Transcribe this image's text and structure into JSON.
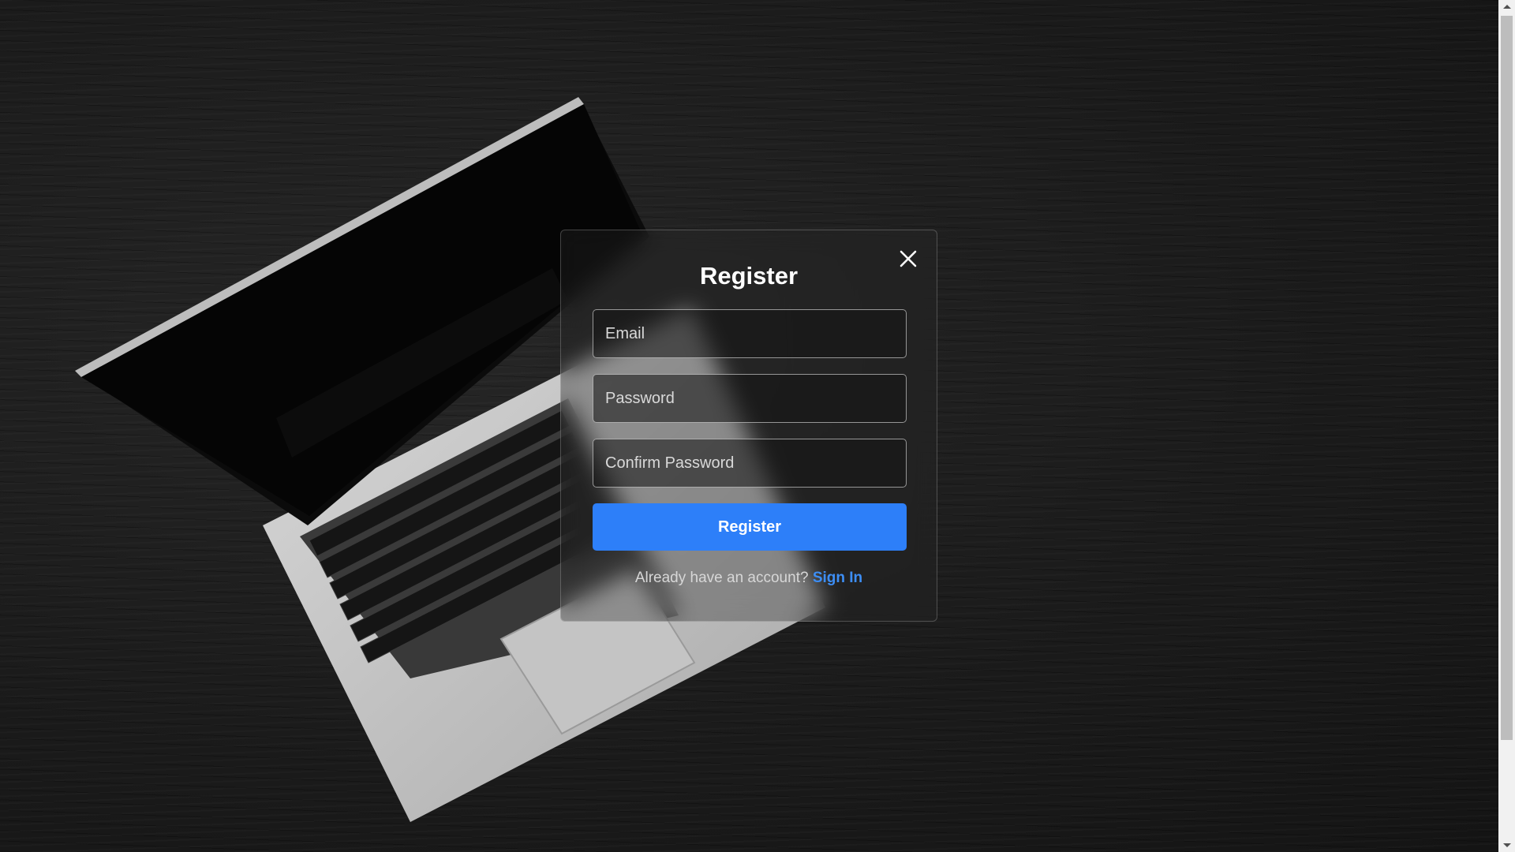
{
  "modal": {
    "title": "Register",
    "close_icon": "close-icon",
    "fields": {
      "email_placeholder": "Email",
      "email_value": "",
      "password_placeholder": "Password",
      "password_value": "",
      "confirm_placeholder": "Confirm Password",
      "confirm_value": ""
    },
    "submit_label": "Register",
    "footer_text": "Already have an account? ",
    "footer_link": "Sign In"
  },
  "colors": {
    "accent": "#2d7ff9",
    "link": "#3d8ef5",
    "background": "#1c1c1c"
  },
  "background_image": "laptop-on-dark-wood",
  "scrollbar": {
    "up_icon": "scroll-up-arrow-icon",
    "down_icon": "scroll-down-arrow-icon"
  }
}
